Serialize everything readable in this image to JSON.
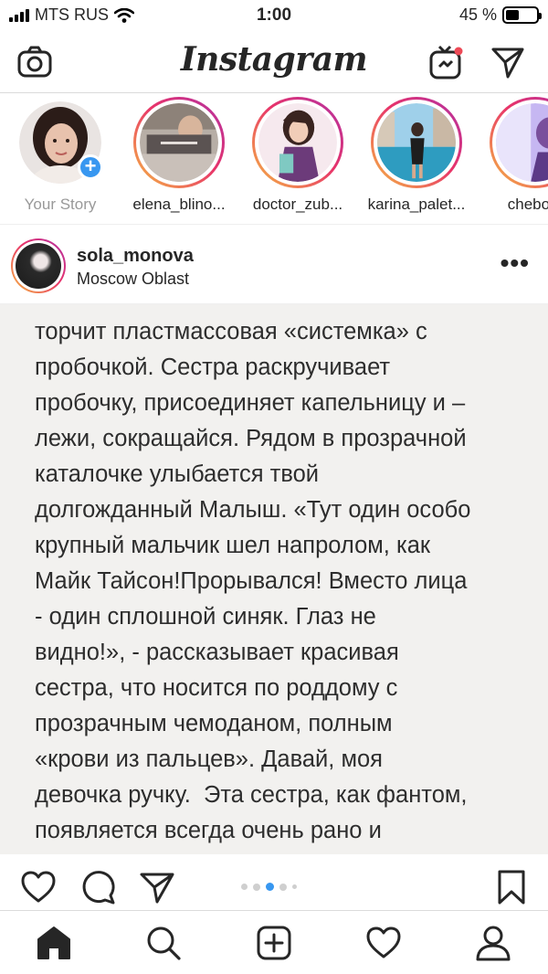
{
  "status_bar": {
    "carrier": "MTS RUS",
    "time": "1:00",
    "battery_percent": "45 %",
    "battery_level": 0.45
  },
  "header": {
    "logo": "Instagram",
    "camera_icon": "camera-icon",
    "igtv_icon": "igtv-icon",
    "direct_icon": "paper-plane-icon"
  },
  "stories": [
    {
      "name": "Your Story",
      "own": true
    },
    {
      "name": "elena_blino..."
    },
    {
      "name": "doctor_zub..."
    },
    {
      "name": "karina_palet..."
    },
    {
      "name": "chebota"
    }
  ],
  "post": {
    "username": "sola_monova",
    "location": "Moscow Oblast",
    "more_icon": "more-horizontal-icon",
    "text_lines": [
      "торчит пластмассовая «системка» с",
      "пробочкой. Сестра раскручивает",
      "пробочку, присоединяет капельницу и –",
      "лежи, сокращайся. Рядом в прозрачной",
      "каталочке улыбается твой",
      "долгожданный Малыш. «Тут один особо",
      "крупный мальчик шел напролом, как",
      "Майк Тайсон!Прорывался! Вместо лица",
      "- один сплошной синяк. Глаз не",
      "видно!», - рассказывает красивая",
      "сестра, что носится по роддому с",
      "прозрачным чемоданом, полным",
      "«крови из пальцев». Давай, моя",
      "девочка ручку.  Эта сестра, как фантом,",
      "появляется всегда очень рано и"
    ],
    "carousel": {
      "count": 5,
      "active_index": 2
    }
  },
  "actions": {
    "like_icon": "heart-icon",
    "comment_icon": "comment-icon",
    "share_icon": "paper-plane-icon",
    "save_icon": "bookmark-icon"
  },
  "tabbar": {
    "home_icon": "home-icon",
    "search_icon": "search-icon",
    "add_icon": "add-post-icon",
    "activity_icon": "heart-icon",
    "profile_icon": "profile-icon"
  },
  "colors": {
    "ring_gradient": [
      "#f5b942",
      "#e8336a",
      "#b031a6"
    ],
    "add_badge": "#3897f0",
    "carousel_active": "#3897f0",
    "photo_background": "#f2f1ef"
  }
}
